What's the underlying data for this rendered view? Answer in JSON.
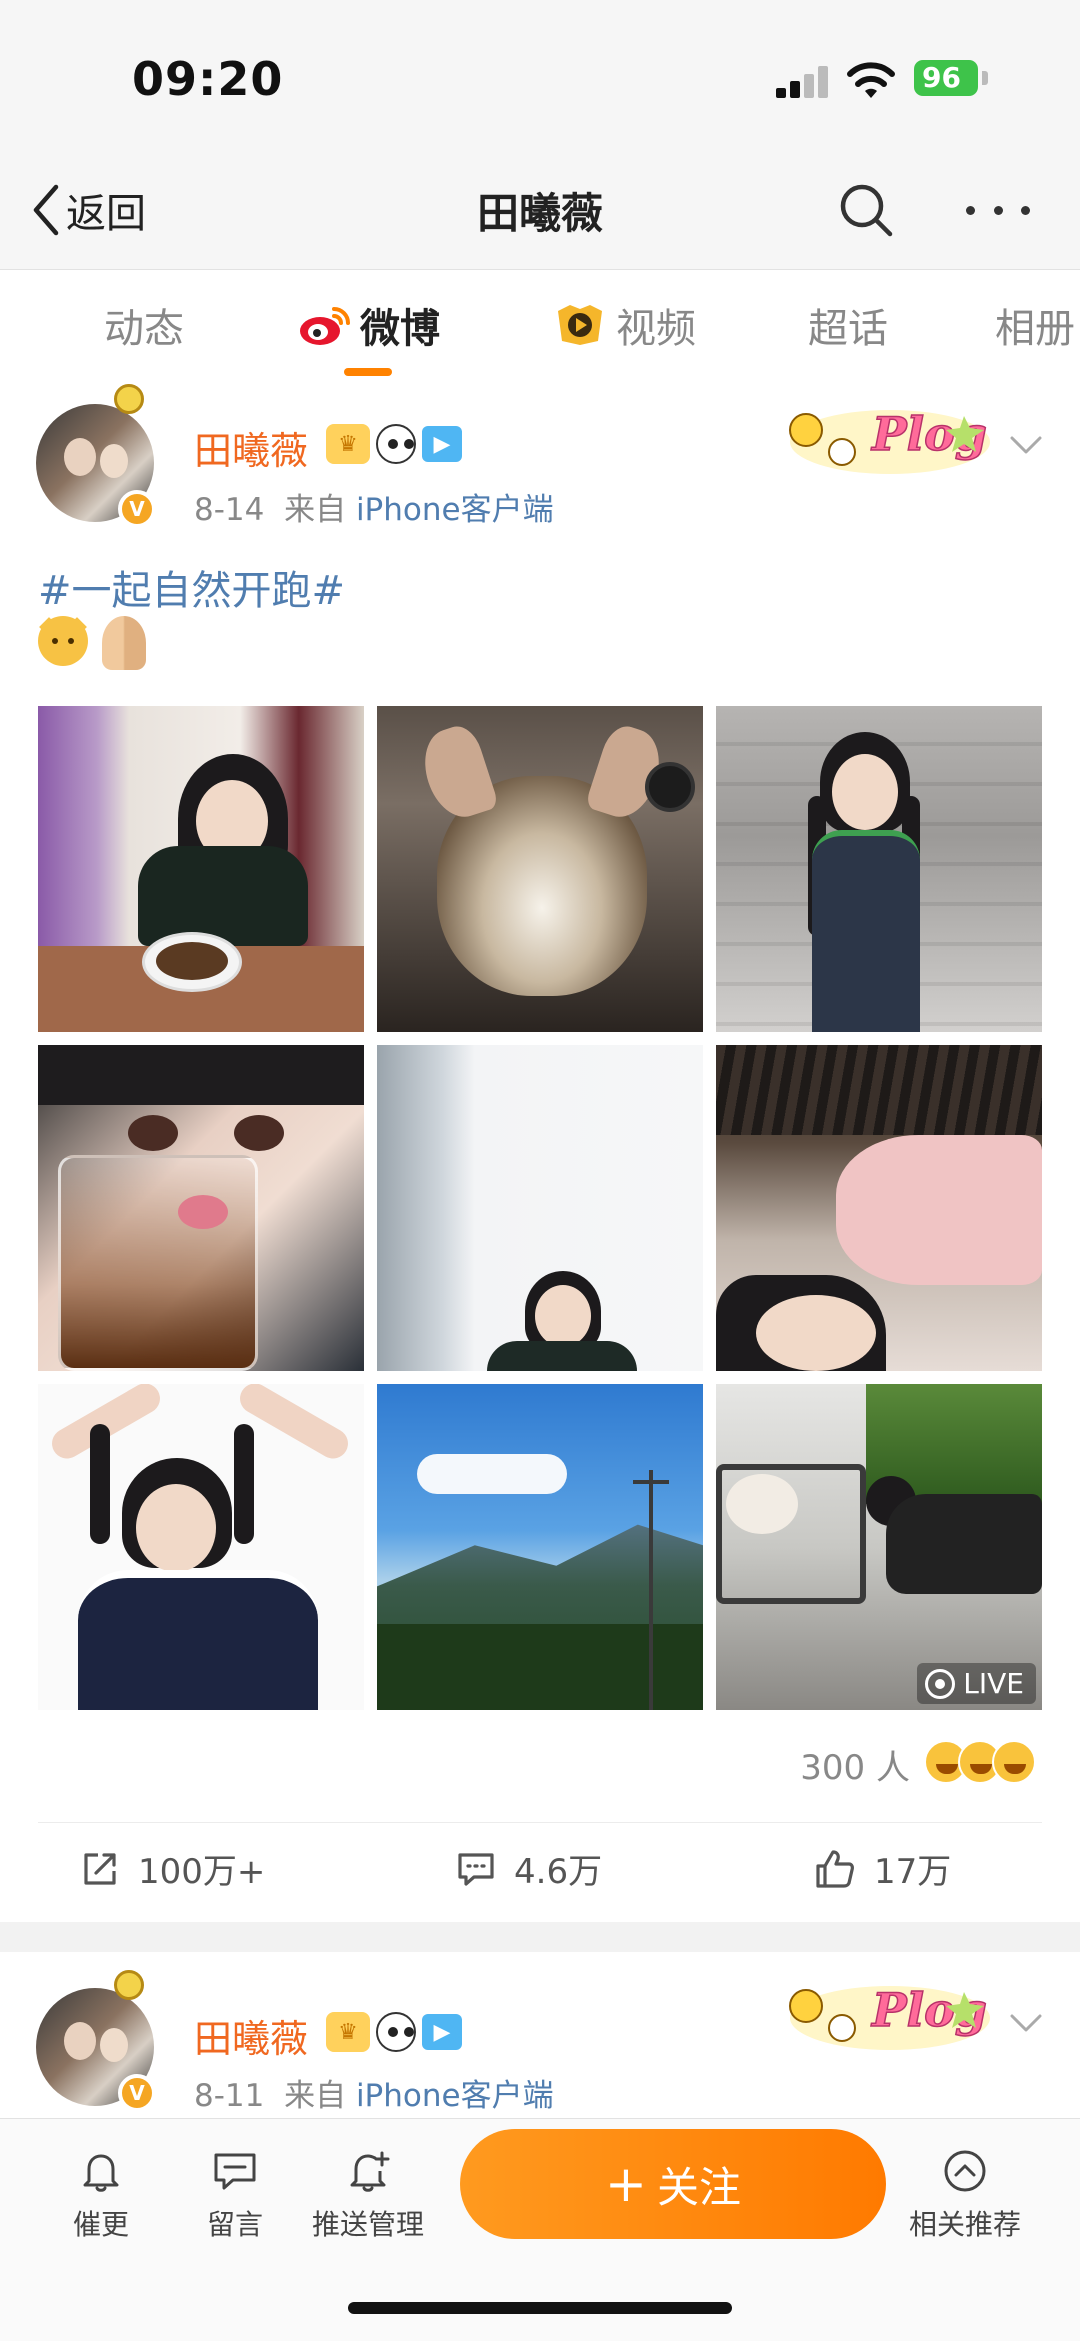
{
  "status_bar": {
    "time": "09:20",
    "battery": "96"
  },
  "nav": {
    "back_label": "返回",
    "title": "田曦薇"
  },
  "tabs": [
    {
      "label": "动态",
      "active": false
    },
    {
      "label": "微博",
      "active": true
    },
    {
      "label": "视频",
      "active": false
    },
    {
      "label": "超话",
      "active": false
    },
    {
      "label": "相册",
      "active": false
    }
  ],
  "posts": [
    {
      "user_name": "田曦薇",
      "date": "8-14",
      "source_prefix": "来自",
      "source": "iPhone客户端",
      "topic": "#一起自然开跑#",
      "emojis": [
        "cat-face-emoji",
        "folded-hands-emoji"
      ],
      "images": [
        {
          "name": "photo-girl-eating-noodles",
          "live": false
        },
        {
          "name": "photo-fluffy-cat",
          "live": false
        },
        {
          "name": "photo-girl-braids-standing",
          "live": false
        },
        {
          "name": "photo-girl-drinking-glass",
          "live": false
        },
        {
          "name": "photo-girl-smiling-wall",
          "live": false
        },
        {
          "name": "photo-girl-lying-pink",
          "live": false
        },
        {
          "name": "photo-girl-braids-heart-pose",
          "live": false
        },
        {
          "name": "photo-mountain-landscape",
          "live": false
        },
        {
          "name": "photo-dog-on-chair",
          "live": true
        }
      ],
      "live_label": "LIVE",
      "reaction_count": "300 人",
      "actions": {
        "repost": "100万+",
        "comment": "4.6万",
        "like": "17万"
      }
    },
    {
      "user_name": "田曦薇",
      "date": "8-11",
      "source_prefix": "来自",
      "source": "iPhone客户端"
    }
  ],
  "toolbar": {
    "urge": "催更",
    "message": "留言",
    "push_manage": "推送管理",
    "follow": "关注",
    "follow_plus": "+",
    "related": "相关推荐"
  },
  "colors": {
    "accent": "#ff8200",
    "name": "#f06820",
    "link": "#507daf"
  }
}
